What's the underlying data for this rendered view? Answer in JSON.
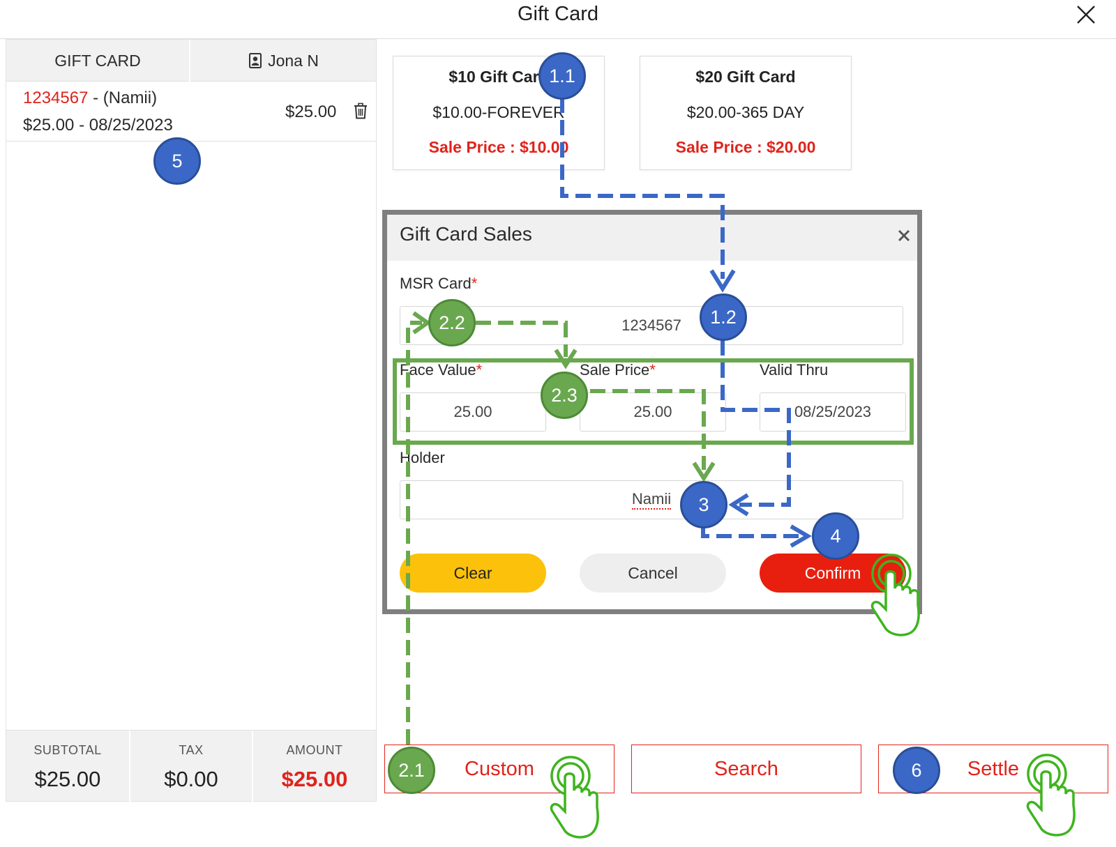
{
  "header": {
    "title": "Gift Card"
  },
  "left_panel": {
    "tab_gift_card": "GIFT CARD",
    "user_name": "Jona N",
    "item": {
      "card_number": "1234567",
      "holder_text": " - (Namii)",
      "amount_date": "$25.00 - 08/25/2023",
      "price": "$25.00"
    },
    "totals": {
      "subtotal_label": "SUBTOTAL",
      "subtotal_value": "$25.00",
      "tax_label": "TAX",
      "tax_value": "$0.00",
      "amount_label": "AMOUNT",
      "amount_value": "$25.00"
    }
  },
  "gift_cards": [
    {
      "name": "$10 Gift Card",
      "desc": "$10.00-FOREVER",
      "sale": "Sale Price : $10.00"
    },
    {
      "name": "$20 Gift Card",
      "desc": "$20.00-365 DAY",
      "sale": "Sale Price : $20.00"
    }
  ],
  "modal": {
    "title": "Gift Card Sales",
    "msr_label": "MSR Card",
    "msr_value": "1234567",
    "face_label": "Face Value",
    "face_value": "25.00",
    "sale_label": "Sale Price",
    "sale_value": "25.00",
    "valid_label": "Valid Thru",
    "valid_value": "08/25/2023",
    "holder_label": "Holder",
    "holder_value": "Namii",
    "required_mark": "*",
    "clear_label": "Clear",
    "cancel_label": "Cancel",
    "confirm_label": "Confirm"
  },
  "bottom_buttons": {
    "custom": "Custom",
    "search": "Search",
    "settle": "Settle"
  },
  "annotations": {
    "step_1_1": "1.1",
    "step_1_2": "1.2",
    "step_2_1": "2.1",
    "step_2_2": "2.2",
    "step_2_3": "2.3",
    "step_3": "3",
    "step_4": "4",
    "step_5": "5",
    "step_6": "6"
  },
  "colors": {
    "accent_red": "#e0231b",
    "clear_yellow": "#fcc10a",
    "confirm_red": "#e81f0f",
    "annotation_blue": "#3b68c6",
    "annotation_green": "#6aa84f"
  }
}
